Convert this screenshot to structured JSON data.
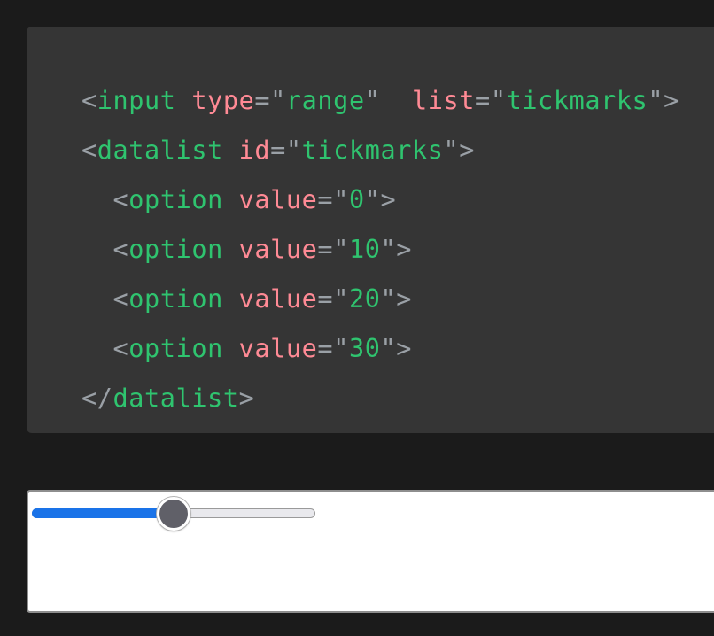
{
  "code": {
    "lines": [
      {
        "indent": "",
        "tokens": [
          {
            "t": "<",
            "k": "punct"
          },
          {
            "t": "input",
            "k": "tag"
          },
          {
            "t": " ",
            "k": "punct"
          },
          {
            "t": "type",
            "k": "attr"
          },
          {
            "t": "=",
            "k": "punct"
          },
          {
            "t": "\"",
            "k": "punct"
          },
          {
            "t": "range",
            "k": "str"
          },
          {
            "t": "\"",
            "k": "punct"
          },
          {
            "t": "  ",
            "k": "punct"
          },
          {
            "t": "list",
            "k": "attr"
          },
          {
            "t": "=",
            "k": "punct"
          },
          {
            "t": "\"",
            "k": "punct"
          },
          {
            "t": "tickmarks",
            "k": "str"
          },
          {
            "t": "\"",
            "k": "punct"
          },
          {
            "t": ">",
            "k": "punct"
          }
        ]
      },
      {
        "indent": "",
        "tokens": [
          {
            "t": "<",
            "k": "punct"
          },
          {
            "t": "datalist",
            "k": "tag"
          },
          {
            "t": " ",
            "k": "punct"
          },
          {
            "t": "id",
            "k": "attr"
          },
          {
            "t": "=",
            "k": "punct"
          },
          {
            "t": "\"",
            "k": "punct"
          },
          {
            "t": "tickmarks",
            "k": "str"
          },
          {
            "t": "\"",
            "k": "punct"
          },
          {
            "t": ">",
            "k": "punct"
          }
        ]
      },
      {
        "indent": "  ",
        "tokens": [
          {
            "t": "<",
            "k": "punct"
          },
          {
            "t": "option",
            "k": "tag"
          },
          {
            "t": " ",
            "k": "punct"
          },
          {
            "t": "value",
            "k": "attr"
          },
          {
            "t": "=",
            "k": "punct"
          },
          {
            "t": "\"",
            "k": "punct"
          },
          {
            "t": "0",
            "k": "str"
          },
          {
            "t": "\"",
            "k": "punct"
          },
          {
            "t": ">",
            "k": "punct"
          }
        ]
      },
      {
        "indent": "  ",
        "tokens": [
          {
            "t": "<",
            "k": "punct"
          },
          {
            "t": "option",
            "k": "tag"
          },
          {
            "t": " ",
            "k": "punct"
          },
          {
            "t": "value",
            "k": "attr"
          },
          {
            "t": "=",
            "k": "punct"
          },
          {
            "t": "\"",
            "k": "punct"
          },
          {
            "t": "10",
            "k": "str"
          },
          {
            "t": "\"",
            "k": "punct"
          },
          {
            "t": ">",
            "k": "punct"
          }
        ]
      },
      {
        "indent": "  ",
        "tokens": [
          {
            "t": "<",
            "k": "punct"
          },
          {
            "t": "option",
            "k": "tag"
          },
          {
            "t": " ",
            "k": "punct"
          },
          {
            "t": "value",
            "k": "attr"
          },
          {
            "t": "=",
            "k": "punct"
          },
          {
            "t": "\"",
            "k": "punct"
          },
          {
            "t": "20",
            "k": "str"
          },
          {
            "t": "\"",
            "k": "punct"
          },
          {
            "t": ">",
            "k": "punct"
          }
        ]
      },
      {
        "indent": "  ",
        "tokens": [
          {
            "t": "<",
            "k": "punct"
          },
          {
            "t": "option",
            "k": "tag"
          },
          {
            "t": " ",
            "k": "punct"
          },
          {
            "t": "value",
            "k": "attr"
          },
          {
            "t": "=",
            "k": "punct"
          },
          {
            "t": "\"",
            "k": "punct"
          },
          {
            "t": "30",
            "k": "str"
          },
          {
            "t": "\"",
            "k": "punct"
          },
          {
            "t": ">",
            "k": "punct"
          }
        ]
      },
      {
        "indent": "",
        "tokens": [
          {
            "t": "</",
            "k": "punct"
          },
          {
            "t": "datalist",
            "k": "tag"
          },
          {
            "t": ">",
            "k": "punct"
          }
        ]
      }
    ]
  },
  "colors": {
    "page_bg": "#1b1b1b",
    "code_bg": "#353535",
    "tag": "#2fc46f",
    "attribute": "#ff8a95",
    "punctuation": "#9aa0a6",
    "slider_fill": "#1a73e8",
    "slider_thumb": "#606068"
  },
  "preview": {
    "slider": {
      "fill_fraction": 0.5
    }
  }
}
